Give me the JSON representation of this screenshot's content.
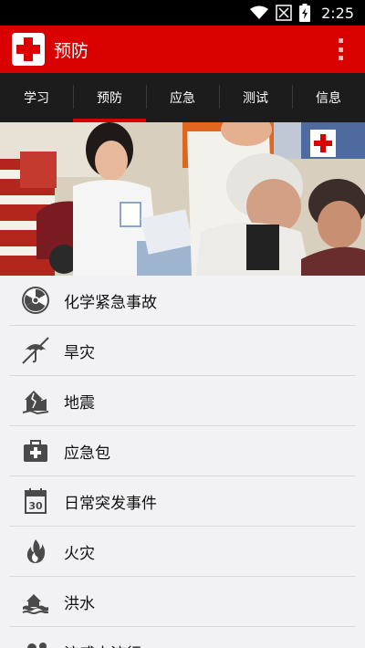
{
  "status_bar": {
    "time": "2:25"
  },
  "app_bar": {
    "title": "预防"
  },
  "tabs": [
    {
      "label": "学习",
      "active": false
    },
    {
      "label": "预防",
      "active": true
    },
    {
      "label": "应急",
      "active": false
    },
    {
      "label": "测试",
      "active": false
    },
    {
      "label": "信息",
      "active": false
    }
  ],
  "list": [
    {
      "label": "化学紧急事故",
      "icon": "radiation-icon"
    },
    {
      "label": "旱灾",
      "icon": "drought-umbrella-icon"
    },
    {
      "label": "地震",
      "icon": "earthquake-house-icon"
    },
    {
      "label": "应急包",
      "icon": "first-aid-kit-icon"
    },
    {
      "label": "日常突发事件",
      "icon": "calendar-icon"
    },
    {
      "label": "火灾",
      "icon": "fire-icon"
    },
    {
      "label": "洪水",
      "icon": "flood-icon"
    },
    {
      "label": "流感大流行",
      "icon": "pandemic-icon"
    }
  ],
  "banner": {
    "calendar_day": "30"
  },
  "colors": {
    "brand_red": "#d90000",
    "tab_bar": "#1c1c1c",
    "list_bg": "#f2f2f4"
  }
}
